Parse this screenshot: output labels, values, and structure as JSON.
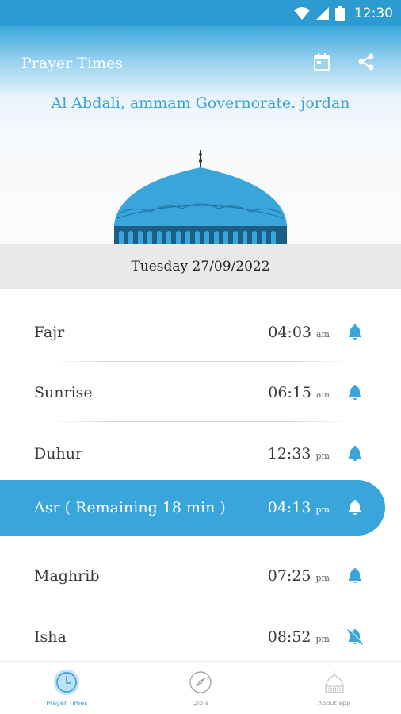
{
  "status_bar": {
    "time": "12:30"
  },
  "header": {
    "title": "Prayer Times",
    "location": "Al Abdali, ammam Governorate. jordan"
  },
  "date": "Tuesday 27/09/2022",
  "prayers": [
    {
      "name": "Fajr",
      "time": "04:03",
      "ampm": "am",
      "alert": "on"
    },
    {
      "name": "Sunrise",
      "time": "06:15",
      "ampm": "am",
      "alert": "on"
    },
    {
      "name": "Duhur",
      "time": "12:33",
      "ampm": "pm",
      "alert": "on"
    },
    {
      "name": "Asr ( Remaining 18 min )",
      "time": "04:13",
      "ampm": "pm",
      "alert": "on",
      "active": true
    },
    {
      "name": "Maghrib",
      "time": "07:25",
      "ampm": "pm",
      "alert": "on"
    },
    {
      "name": "Isha",
      "time": "08:52",
      "ampm": "pm",
      "alert": "off"
    }
  ],
  "bottom_nav": [
    {
      "label": "Prayer Times",
      "icon": "clock-icon",
      "active": true
    },
    {
      "label": "Qibla",
      "icon": "compass-icon"
    },
    {
      "label": "About app",
      "icon": "mosque-icon"
    }
  ],
  "colors": {
    "accent": "#3aa5db",
    "status_bar": "#2c9bd1"
  }
}
